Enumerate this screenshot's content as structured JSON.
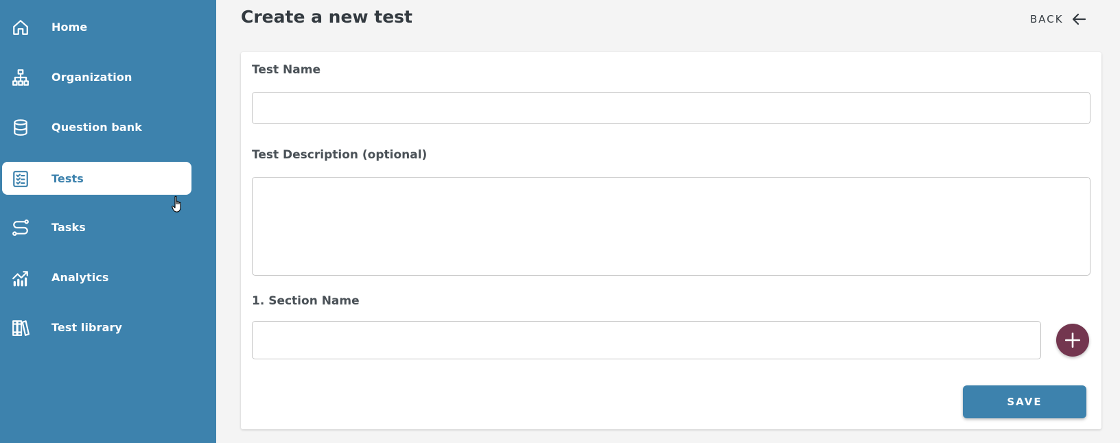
{
  "sidebar": {
    "items": [
      {
        "label": "Home",
        "icon": "home-icon"
      },
      {
        "label": "Organization",
        "icon": "hierarchy-icon"
      },
      {
        "label": "Question bank",
        "icon": "database-icon"
      },
      {
        "label": "Tests",
        "icon": "checklist-icon",
        "active": true
      },
      {
        "label": "Tasks",
        "icon": "route-icon"
      },
      {
        "label": "Analytics",
        "icon": "chart-icon"
      },
      {
        "label": "Test library",
        "icon": "books-icon"
      }
    ]
  },
  "header": {
    "title": "Create a new test",
    "back_label": "BACK"
  },
  "form": {
    "test_name_label": "Test Name",
    "test_name_value": "",
    "description_label": "Test Description (optional)",
    "description_value": "",
    "section_label": "1. Section Name",
    "section_value": "",
    "save_label": "SAVE"
  },
  "colors": {
    "sidebar": "#3d82ad",
    "accent": "#73364f",
    "primary_button": "#3d82ad"
  }
}
